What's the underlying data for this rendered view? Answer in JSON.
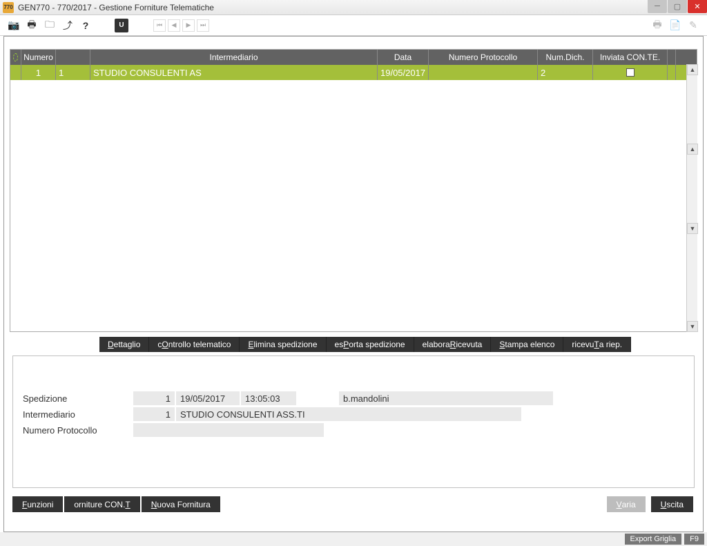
{
  "window": {
    "app_code": "770",
    "title": "GEN770  - 770/2017 -  Gestione Forniture Telematiche"
  },
  "toolbar": {
    "icons": [
      "camera",
      "print",
      "folder",
      "upload",
      "help"
    ],
    "box_label": "U"
  },
  "grid": {
    "headers": {
      "numero": "Numero",
      "intermediario": "Intermediario",
      "data": "Data",
      "num_protocollo": "Numero Protocollo",
      "num_dich": "Num.Dich.",
      "inviata": "Inviata CON.TE."
    },
    "row": {
      "numero": "1",
      "seq": "1",
      "intermediario": "STUDIO CONSULENTI AS",
      "data": "19/05/2017",
      "num_protocollo": "",
      "num_dich": "2",
      "inviata_checked": false
    }
  },
  "actions": {
    "dettaglio": "Dettaglio",
    "controllo": "cOntrollo telematico",
    "elimina": "Elimina spedizione",
    "esporta": "esPorta spedizione",
    "elabora": "elabora Ricevuta",
    "stampa": "Stampa elenco",
    "ricevuta": "ricevuTa riep."
  },
  "detail": {
    "spedizione_label": "Spedizione",
    "spedizione_num": "1",
    "spedizione_date": "19/05/2017",
    "spedizione_time": "13:05:03",
    "spedizione_user": "b.mandolini",
    "intermediario_label": "Intermediario",
    "intermediario_num": "1",
    "intermediario_name": "STUDIO CONSULENTI ASS.TI",
    "protocollo_label": "Numero Protocollo",
    "protocollo_value": ""
  },
  "bottom": {
    "funzioni": "Funzioni",
    "forniture": "orniture CON.TE",
    "nuova": "Nuova Fornitura",
    "varia": "Varia",
    "uscita": "Uscita"
  },
  "status": {
    "export": "Export Griglia",
    "f9": "F9"
  }
}
